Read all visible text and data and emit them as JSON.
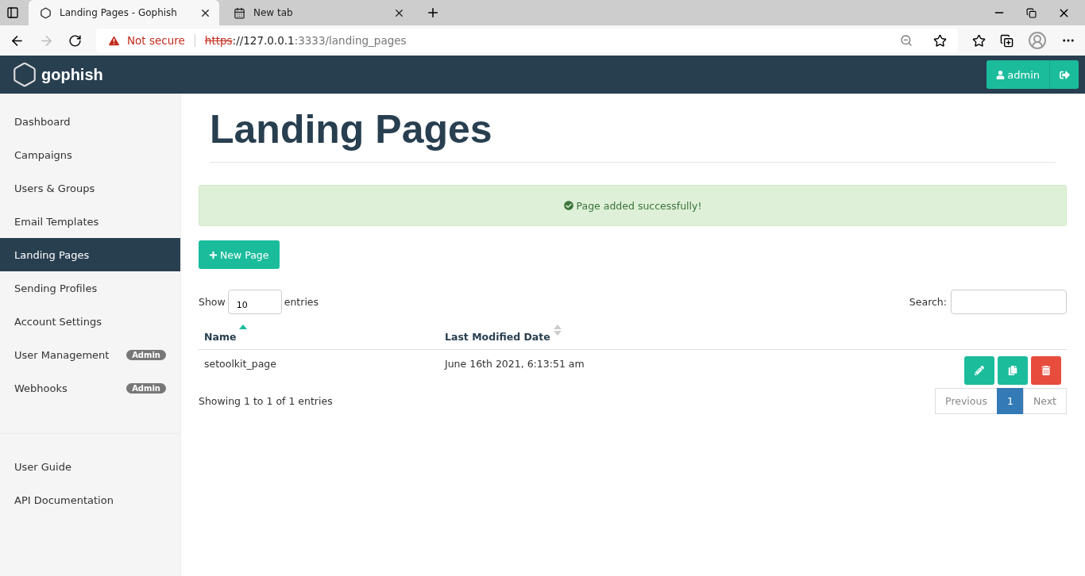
{
  "browser": {
    "tabs": [
      {
        "title": "Landing Pages - Gophish",
        "selected": true,
        "kind": "site"
      },
      {
        "title": "New tab",
        "selected": false,
        "kind": "newtab"
      }
    ],
    "security": "Not secure",
    "url": {
      "scheme": "https",
      "host": "://127.0.0.1",
      "rest": ":3333/landing_pages"
    }
  },
  "navbar": {
    "brand": "gophish",
    "user": "admin"
  },
  "sidebar": {
    "items": [
      {
        "label": "Dashboard",
        "selected": false
      },
      {
        "label": "Campaigns",
        "selected": false
      },
      {
        "label": "Users & Groups",
        "selected": false
      },
      {
        "label": "Email Templates",
        "selected": false
      },
      {
        "label": "Landing Pages",
        "selected": true
      },
      {
        "label": "Sending Profiles",
        "selected": false
      },
      {
        "label": "Account Settings",
        "selected": false
      },
      {
        "label": "User Management",
        "selected": false,
        "badge": "Admin"
      },
      {
        "label": "Webhooks",
        "selected": false,
        "badge": "Admin"
      }
    ],
    "footer_items": [
      {
        "label": "User Guide",
        "selected": false
      },
      {
        "label": "API Documentation",
        "selected": false
      }
    ]
  },
  "page": {
    "title": "Landing Pages",
    "alert": "Page added successfully!",
    "new_button": "New Page",
    "length": {
      "before": "Show",
      "value": "10",
      "after": "entries"
    },
    "search_label": "Search:",
    "table": {
      "columns": [
        {
          "label": "Name",
          "sorted": true
        },
        {
          "label": "Last Modified Date",
          "sorted": false
        }
      ],
      "rows": [
        {
          "cells": [
            "setoolkit_page",
            "June 16th 2021, 6:13:51 am"
          ]
        }
      ]
    },
    "info": "Showing 1 to 1 of 1 entries",
    "pagination": {
      "previous": {
        "label": "Previous",
        "disabled": true
      },
      "pages": [
        {
          "label": "1",
          "selected": true
        }
      ],
      "next": {
        "label": "Next",
        "disabled": true
      }
    }
  }
}
